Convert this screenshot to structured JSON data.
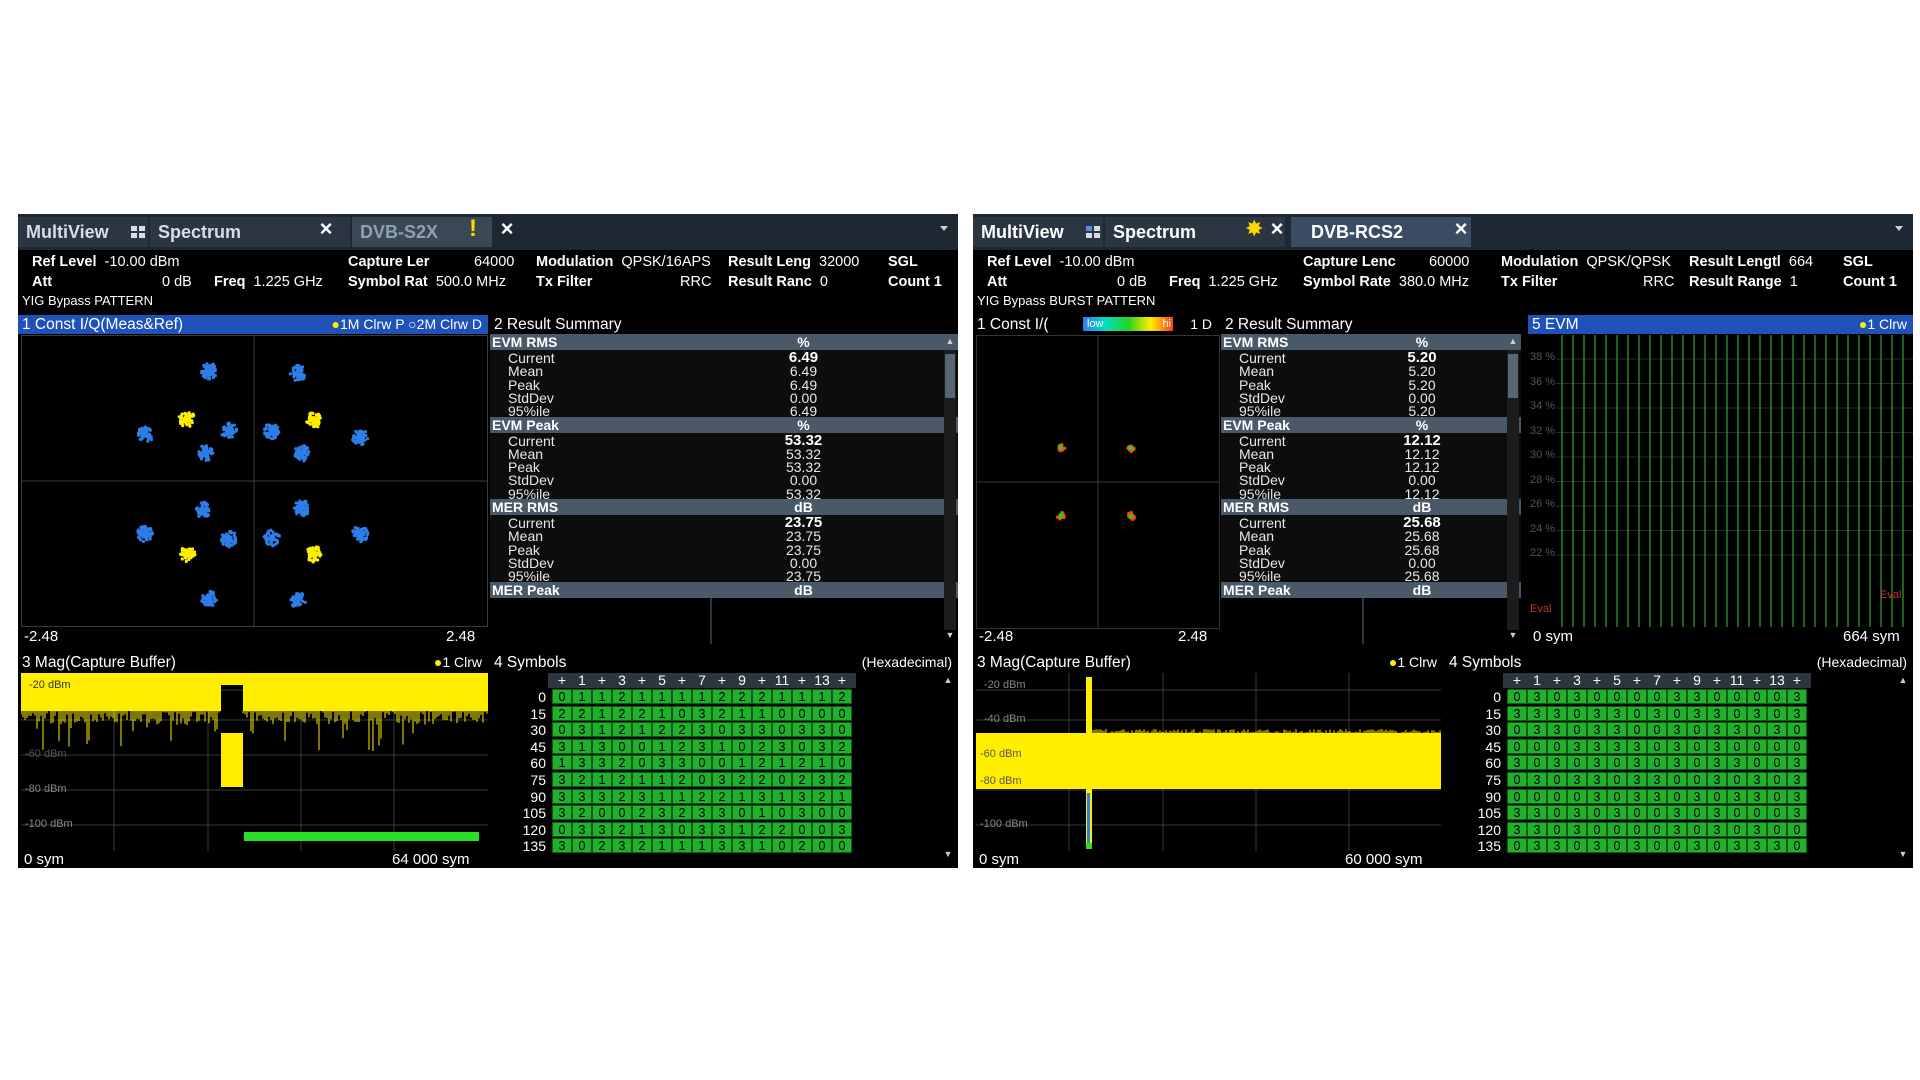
{
  "screens": [
    {
      "tabs": [
        "MultiView",
        "Spectrum",
        "DVB-S2X"
      ],
      "info": {
        "ref_level_label": "Ref Level",
        "ref_level_value": "-10.00 dBm",
        "att_label": "Att",
        "att_value": "0 dB",
        "freq_label": "Freq",
        "freq_value": "1.225 GHz",
        "capture_label": "Capture Ler",
        "capture_value": "64000",
        "symrate_label": "Symbol Rat",
        "symrate_value": "500.0 MHz",
        "modulation_label": "Modulation",
        "modulation_value": "QPSK/16APS",
        "txfilter_label": "Tx Filter",
        "txfilter_value": "RRC",
        "resultlen_label": "Result Leng",
        "resultlen_value": "32000",
        "resultrange_label": "Result Ranc",
        "resultrange_value": "0",
        "sgl": "SGL",
        "count": "Count 1",
        "yig": "YIG Bypass PATTERN"
      },
      "const": {
        "title": "1 Const I/Q(Meas&Ref)",
        "legend": "1M Clrw P",
        "legend2": "2M Clrw D",
        "xmin": "-2.48",
        "xmax": "2.48"
      },
      "summary": {
        "title": "2 Result Summary",
        "sections": [
          {
            "name": "EVM RMS",
            "unit": "%",
            "rows": [
              {
                "name": "Current",
                "value": "6.49"
              },
              {
                "name": "Mean",
                "value": "6.49"
              },
              {
                "name": "Peak",
                "value": "6.49"
              },
              {
                "name": "StdDev",
                "value": "0.00"
              },
              {
                "name": "95%ile",
                "value": "6.49"
              }
            ]
          },
          {
            "name": "EVM Peak",
            "unit": "%",
            "rows": [
              {
                "name": "Current",
                "value": "53.32"
              },
              {
                "name": "Mean",
                "value": "53.32"
              },
              {
                "name": "Peak",
                "value": "53.32"
              },
              {
                "name": "StdDev",
                "value": "0.00"
              },
              {
                "name": "95%ile",
                "value": "53.32"
              }
            ]
          },
          {
            "name": "MER RMS",
            "unit": "dB",
            "rows": [
              {
                "name": "Current",
                "value": "23.75"
              },
              {
                "name": "Mean",
                "value": "23.75"
              },
              {
                "name": "Peak",
                "value": "23.75"
              },
              {
                "name": "StdDev",
                "value": "0.00"
              },
              {
                "name": "95%ile",
                "value": "23.75"
              }
            ]
          },
          {
            "name": "MER Peak",
            "unit": "dB",
            "rows": []
          }
        ]
      },
      "mag": {
        "title": "3 Mag(Capture Buffer)",
        "legend": "1 Clrw",
        "ylabels": [
          "-20 dBm",
          "-60 dBm",
          "-80 dBm",
          "-100 dBm"
        ],
        "xmin": "0 sym",
        "xmax": "64 000 sym"
      },
      "symbols": {
        "title": "4 Symbols",
        "format": "(Hexadecimal)",
        "header": [
          "+",
          "1",
          "+",
          "3",
          "+",
          "5",
          "+",
          "7",
          "+",
          "9",
          "+",
          "11",
          "+",
          "13",
          "+"
        ],
        "rowlabels": [
          "0",
          "15",
          "30",
          "45",
          "60",
          "75",
          "90",
          "105",
          "120",
          "135"
        ],
        "rows": [
          [
            "0",
            "1",
            "1",
            "2",
            "1",
            "1",
            "1",
            "1",
            "2",
            "2",
            "2",
            "1",
            "1",
            "1",
            "2"
          ],
          [
            "2",
            "2",
            "1",
            "2",
            "2",
            "1",
            "0",
            "3",
            "2",
            "1",
            "1",
            "0",
            "0",
            "0",
            "0"
          ],
          [
            "0",
            "3",
            "1",
            "2",
            "1",
            "2",
            "2",
            "3",
            "0",
            "3",
            "3",
            "0",
            "3",
            "3",
            "0"
          ],
          [
            "3",
            "1",
            "3",
            "0",
            "0",
            "1",
            "2",
            "3",
            "1",
            "0",
            "2",
            "3",
            "0",
            "3",
            "2"
          ],
          [
            "1",
            "3",
            "3",
            "2",
            "0",
            "3",
            "3",
            "0",
            "0",
            "1",
            "2",
            "1",
            "2",
            "1",
            "0"
          ],
          [
            "3",
            "2",
            "1",
            "2",
            "1",
            "1",
            "2",
            "0",
            "3",
            "2",
            "2",
            "0",
            "2",
            "3",
            "2"
          ],
          [
            "3",
            "3",
            "3",
            "2",
            "3",
            "1",
            "1",
            "2",
            "2",
            "1",
            "3",
            "1",
            "3",
            "2",
            "1"
          ],
          [
            "3",
            "2",
            "0",
            "0",
            "2",
            "3",
            "2",
            "3",
            "3",
            "0",
            "1",
            "0",
            "3",
            "0",
            "0"
          ],
          [
            "0",
            "3",
            "3",
            "2",
            "1",
            "3",
            "0",
            "3",
            "3",
            "1",
            "2",
            "2",
            "0",
            "0",
            "3"
          ],
          [
            "3",
            "0",
            "2",
            "3",
            "2",
            "1",
            "1",
            "1",
            "3",
            "3",
            "1",
            "0",
            "2",
            "0",
            "0"
          ]
        ]
      }
    },
    {
      "tabs": [
        "MultiView",
        "Spectrum",
        "DVB-RCS2"
      ],
      "info": {
        "ref_level_label": "Ref Level",
        "ref_level_value": "-10.00 dBm",
        "att_label": "Att",
        "att_value": "0 dB",
        "freq_label": "Freq",
        "freq_value": "1.225 GHz",
        "capture_label": "Capture Lenc",
        "capture_value": "60000",
        "symrate_label": "Symbol Rate",
        "symrate_value": "380.0 MHz",
        "modulation_label": "Modulation",
        "modulation_value": "QPSK/QPSK",
        "txfilter_label": "Tx Filter",
        "txfilter_value": "RRC",
        "resultlen_label": "Result Lengtl",
        "resultlen_value": "664",
        "resultrange_label": "Result Range",
        "resultrange_value": "1",
        "sgl": "SGL",
        "count": "Count 1",
        "yig": "YIG Bypass BURST PATTERN"
      },
      "const": {
        "title": "1 Const I/(",
        "legend": "1 D",
        "colorbar_low": "low",
        "colorbar_high": "hi",
        "xmin": "-2.48",
        "xmax": "2.48"
      },
      "summary": {
        "title": "2 Result Summary",
        "sections": [
          {
            "name": "EVM RMS",
            "unit": "%",
            "rows": [
              {
                "name": "Current",
                "value": "5.20"
              },
              {
                "name": "Mean",
                "value": "5.20"
              },
              {
                "name": "Peak",
                "value": "5.20"
              },
              {
                "name": "StdDev",
                "value": "0.00"
              },
              {
                "name": "95%ile",
                "value": "5.20"
              }
            ]
          },
          {
            "name": "EVM Peak",
            "unit": "%",
            "rows": [
              {
                "name": "Current",
                "value": "12.12"
              },
              {
                "name": "Mean",
                "value": "12.12"
              },
              {
                "name": "Peak",
                "value": "12.12"
              },
              {
                "name": "StdDev",
                "value": "0.00"
              },
              {
                "name": "95%ile",
                "value": "12.12"
              }
            ]
          },
          {
            "name": "MER RMS",
            "unit": "dB",
            "rows": [
              {
                "name": "Current",
                "value": "25.68"
              },
              {
                "name": "Mean",
                "value": "25.68"
              },
              {
                "name": "Peak",
                "value": "25.68"
              },
              {
                "name": "StdDev",
                "value": "0.00"
              },
              {
                "name": "95%ile",
                "value": "25.68"
              }
            ]
          },
          {
            "name": "MER Peak",
            "unit": "dB",
            "rows": []
          }
        ]
      },
      "evm": {
        "title": "5 EVM",
        "legend": "1 Clrw",
        "ylabels": [
          "38 %",
          "36 %",
          "34 %",
          "32 %",
          "30 %",
          "28 %",
          "26 %",
          "24 %",
          "22 %"
        ],
        "eval_label": "Eval",
        "xmin": "0 sym",
        "xmax": "664 sym"
      },
      "mag": {
        "title": "3 Mag(Capture Buffer)",
        "legend": "1 Clrw",
        "ylabels": [
          "-20 dBm",
          "-40 dBm",
          "-60 dBm",
          "-80 dBm",
          "-100 dBm"
        ],
        "xmin": "0 sym",
        "xmax": "60 000 sym"
      },
      "symbols": {
        "title": "4 Symbols",
        "format": "(Hexadecimal)",
        "header": [
          "+",
          "1",
          "+",
          "3",
          "+",
          "5",
          "+",
          "7",
          "+",
          "9",
          "+",
          "11",
          "+",
          "13",
          "+"
        ],
        "rowlabels": [
          "0",
          "15",
          "30",
          "45",
          "60",
          "75",
          "90",
          "105",
          "120",
          "135"
        ],
        "rows": [
          [
            "0",
            "3",
            "0",
            "3",
            "0",
            "0",
            "0",
            "0",
            "3",
            "3",
            "0",
            "0",
            "0",
            "0",
            "3"
          ],
          [
            "3",
            "3",
            "3",
            "0",
            "3",
            "3",
            "0",
            "3",
            "0",
            "3",
            "3",
            "0",
            "3",
            "0",
            "3"
          ],
          [
            "0",
            "3",
            "3",
            "0",
            "3",
            "3",
            "0",
            "0",
            "3",
            "0",
            "3",
            "3",
            "0",
            "3",
            "0"
          ],
          [
            "0",
            "0",
            "0",
            "3",
            "3",
            "3",
            "3",
            "0",
            "3",
            "0",
            "3",
            "0",
            "0",
            "0",
            "0"
          ],
          [
            "3",
            "0",
            "3",
            "0",
            "3",
            "0",
            "3",
            "0",
            "3",
            "0",
            "3",
            "3",
            "0",
            "0",
            "3"
          ],
          [
            "0",
            "3",
            "0",
            "3",
            "3",
            "0",
            "3",
            "3",
            "0",
            "0",
            "3",
            "0",
            "3",
            "0",
            "3"
          ],
          [
            "0",
            "0",
            "0",
            "0",
            "3",
            "0",
            "3",
            "3",
            "0",
            "3",
            "0",
            "3",
            "3",
            "0",
            "3"
          ],
          [
            "3",
            "3",
            "0",
            "3",
            "0",
            "3",
            "0",
            "0",
            "3",
            "0",
            "3",
            "0",
            "0",
            "0",
            "3"
          ],
          [
            "3",
            "3",
            "0",
            "3",
            "0",
            "0",
            "0",
            "0",
            "3",
            "0",
            "3",
            "0",
            "3",
            "0",
            "0"
          ],
          [
            "0",
            "3",
            "3",
            "0",
            "3",
            "0",
            "3",
            "0",
            "0",
            "3",
            "0",
            "3",
            "3",
            "3",
            "0"
          ]
        ]
      }
    }
  ],
  "colors": {
    "accent_blue": "#1e52b8",
    "trace_yellow": "#ffee00",
    "symbol_green": "#21b02c",
    "point_blue": "#2f7de6"
  }
}
